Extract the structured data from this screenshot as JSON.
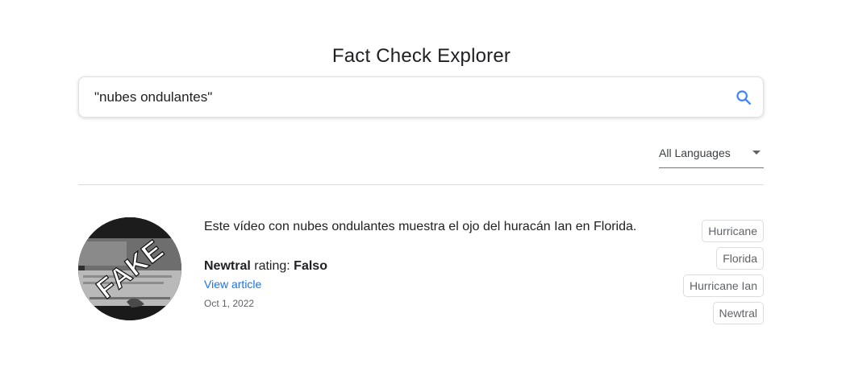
{
  "header": {
    "title": "Fact Check Explorer"
  },
  "search": {
    "value": "\"nubes ondulantes\"",
    "icon": "search-icon"
  },
  "language_filter": {
    "selected": "All Languages"
  },
  "results": [
    {
      "claim": "Este vídeo con nubes ondulantes muestra el ojo del huracán Ian en Florida.",
      "publisher": "Newtral",
      "rating_label": "rating:",
      "rating": "Falso",
      "link_label": "View article",
      "date": "Oct 1, 2022",
      "thumbnail_stamp": "FAKE",
      "tags": [
        "Hurricane",
        "Florida",
        "Hurricane Ian",
        "Newtral"
      ]
    }
  ],
  "colors": {
    "link": "#1a73e8",
    "search_icon": "#4285f4"
  }
}
